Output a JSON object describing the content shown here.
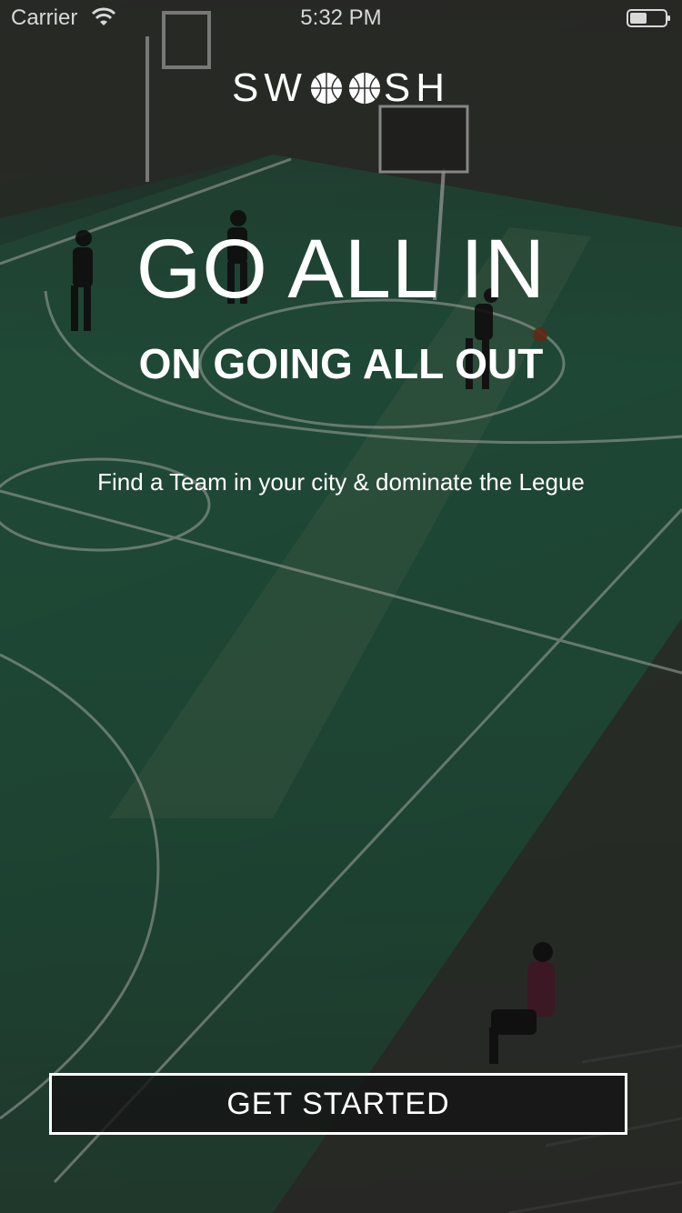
{
  "status_bar": {
    "carrier": "Carrier",
    "time": "5:32 PM"
  },
  "logo": {
    "text_start": "SW",
    "text_end": "SH",
    "icons": [
      "basketball-icon",
      "basketball-icon"
    ]
  },
  "hero": {
    "headline": "GO ALL IN",
    "subheadline": "ON GOING ALL OUT",
    "tagline": "Find a Team in your city & dominate the Legue"
  },
  "actions": {
    "get_started_label": "GET STARTED"
  },
  "colors": {
    "text": "#ffffff",
    "court_green": "#2e6a4e",
    "button_bg": "#141414"
  }
}
